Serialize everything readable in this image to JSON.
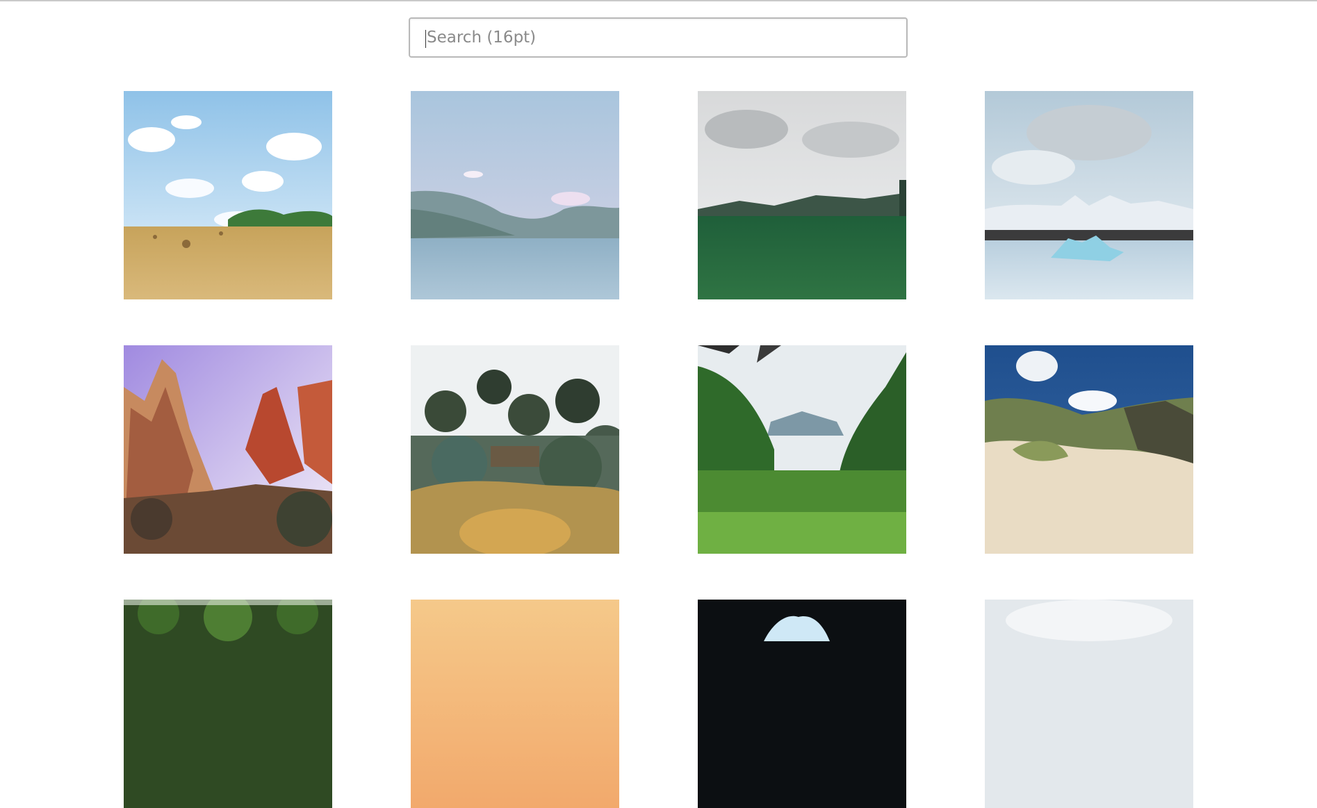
{
  "search": {
    "placeholder": "Search (16pt)",
    "value": ""
  },
  "gallery": {
    "images": [
      {
        "name": "hay-field-blue-sky"
      },
      {
        "name": "mountain-lake"
      },
      {
        "name": "green-meadow-cloudy"
      },
      {
        "name": "iceberg-lagoon"
      },
      {
        "name": "red-rock-canyon"
      },
      {
        "name": "garden-trees"
      },
      {
        "name": "green-valley"
      },
      {
        "name": "sand-dunes"
      },
      {
        "name": "forest-canopy"
      },
      {
        "name": "warm-sunset"
      },
      {
        "name": "ice-cave"
      },
      {
        "name": "cloudy-sky"
      }
    ]
  },
  "colors": {
    "border": "#b9b9b9",
    "placeholder": "#8a8a8a"
  }
}
